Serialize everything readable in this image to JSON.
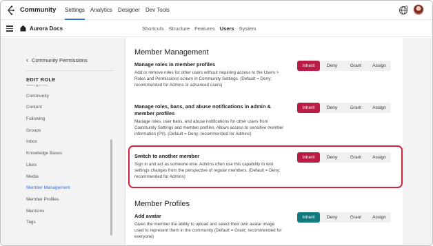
{
  "app": {
    "title": "Community"
  },
  "topnav": [
    {
      "label": "Settings",
      "active": true
    },
    {
      "label": "Analytics",
      "active": false
    },
    {
      "label": "Designer",
      "active": false
    },
    {
      "label": "Dev Tools",
      "active": false
    }
  ],
  "site": {
    "title": "Aurora Docs"
  },
  "subnav": [
    {
      "label": "Shortcuts",
      "active": false
    },
    {
      "label": "Structure",
      "active": false
    },
    {
      "label": "Features",
      "active": false
    },
    {
      "label": "Users",
      "active": true
    },
    {
      "label": "System",
      "active": false
    }
  ],
  "sidebar": {
    "back_label": "Community Permissions",
    "section_label": "EDIT ROLE",
    "items": [
      {
        "label": "Categories",
        "active": false
      },
      {
        "label": "Community",
        "active": false
      },
      {
        "label": "Content",
        "active": false
      },
      {
        "label": "Following",
        "active": false
      },
      {
        "label": "Groups",
        "active": false
      },
      {
        "label": "Inbox",
        "active": false
      },
      {
        "label": "Knowledge Bases",
        "active": false
      },
      {
        "label": "Likes",
        "active": false
      },
      {
        "label": "Media",
        "active": false
      },
      {
        "label": "Member Management",
        "active": true
      },
      {
        "label": "Member Profiles",
        "active": false
      },
      {
        "label": "Mentions",
        "active": false
      },
      {
        "label": "Tags",
        "active": false
      }
    ]
  },
  "main": {
    "section1_title": "Member Management",
    "section2_title": "Member Profiles",
    "permissions": [
      {
        "title": "Manage roles in member profiles",
        "description": "Add or remove roles for other users without requiring access to the Users > Roles and Permissions screen in Community Settings. (Default = Deny; recommended for Admins or advanced users)",
        "selected": "Inherit"
      },
      {
        "title": "Manage roles, bans, and abuse notifications in admin & member profiles",
        "description": "Manage roles, user bans, and abuse notifications for other users from Community Settings and member profiles. Allows access to sensitive member information (PII). (Default = Deny; recommended for Admins)",
        "selected": "Inherit"
      },
      {
        "title": "Switch to another member",
        "description": "Sign in and act as someone else. Admins often use this capability to test settings changes from the perspective of regular members. (Default = Deny; recommended for Admins)",
        "selected": "Inherit"
      },
      {
        "title": "Add avatar",
        "description": "Gives the member the ability to upload and select their own avatar image used to represent them in the community (Default = Grant; recommended for everyone)",
        "selected": "Inherit"
      }
    ],
    "options": {
      "inherit": "Inherit",
      "deny": "Deny",
      "grant": "Grant",
      "assign": "Assign"
    }
  },
  "colors": {
    "accent": "#2f6fe4",
    "selected_red": "#b91c45",
    "selected_teal": "#137a7f",
    "highlight": "#d0243a"
  },
  "icons": {
    "logo": "community-logo-icon",
    "globe": "globe-icon",
    "menu": "hamburger-icon",
    "home": "home-icon",
    "back": "chevron-left-icon"
  }
}
